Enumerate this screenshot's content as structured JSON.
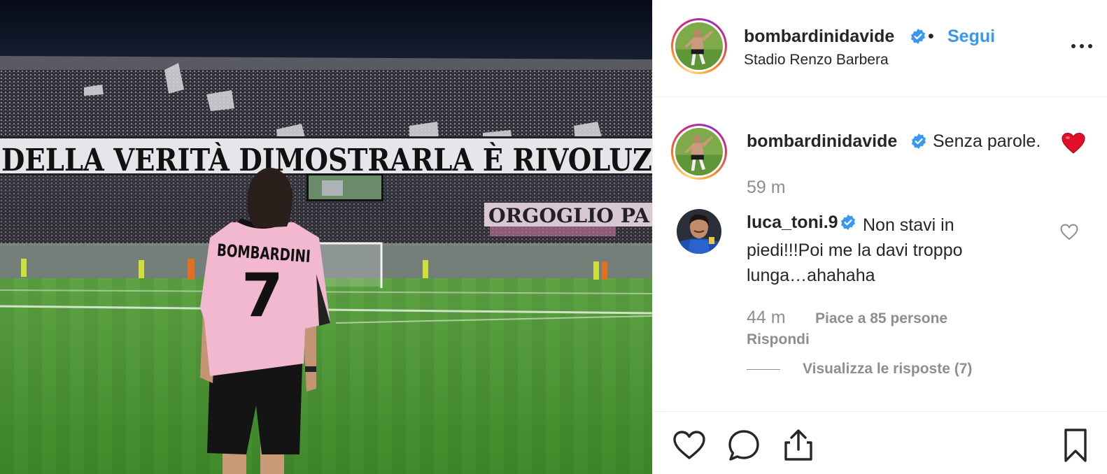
{
  "post": {
    "username": "bombardinidavide",
    "separator": "•",
    "follow_label": "Segui",
    "location": "Stadio Renzo Barbera",
    "photo": {
      "banner_top": "DELLA VERITÀ DIMOSTRARLA È RIVOLUZ",
      "banner_right": "ORGOGLIO PA",
      "shirt_name": "BOMBARDINI",
      "shirt_number": "7"
    }
  },
  "caption": {
    "username": "bombardinidavide",
    "text": "Senza parole.",
    "emoji": "red-heart",
    "time": "59 m"
  },
  "comment": {
    "username": "luca_toni.9",
    "text": "Non stavi in piedi!!!Poi me la davi troppo lunga…ahahaha",
    "time": "44 m",
    "likes": "Piace a 85 persone",
    "reply_label": "Rispondi",
    "view_replies": "Visualizza le risposte (7)"
  },
  "actions": [
    "heart-icon",
    "comment-icon",
    "share-icon",
    "bookmark-icon"
  ],
  "colors": {
    "link_blue": "#3897f0",
    "verified_blue": "#3897f0",
    "secondary_text": "#8e8e8e",
    "shirt_pink": "#f2b8cf",
    "pitch_green": "#4f9a38"
  }
}
